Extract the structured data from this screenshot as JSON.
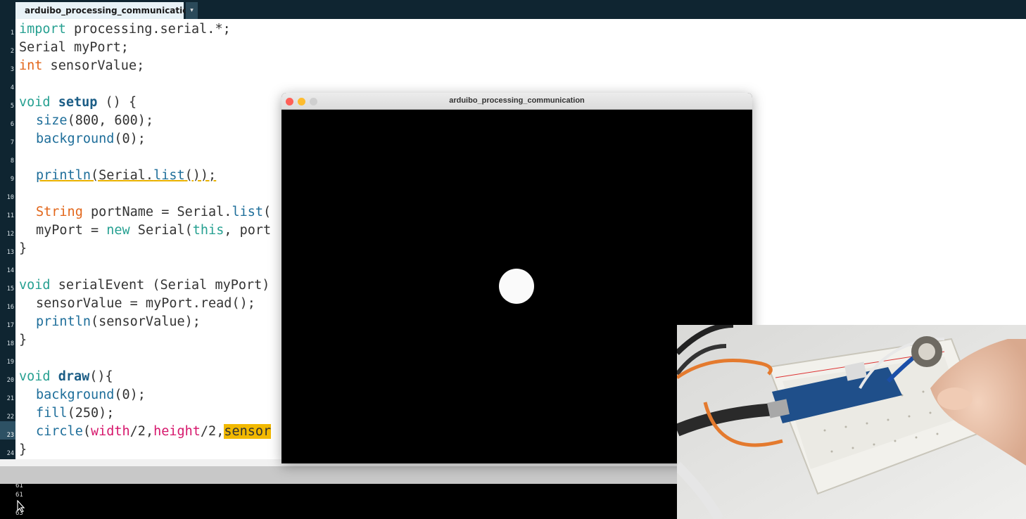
{
  "editor": {
    "tab_label": "arduibo_processing_communication",
    "tab_menu_icon": "▾",
    "current_line": 23,
    "lines": [
      {
        "n": "1"
      },
      {
        "n": "2"
      },
      {
        "n": "3"
      },
      {
        "n": "4"
      },
      {
        "n": "5"
      },
      {
        "n": "6"
      },
      {
        "n": "7"
      },
      {
        "n": "8"
      },
      {
        "n": "9"
      },
      {
        "n": "10"
      },
      {
        "n": "11"
      },
      {
        "n": "12"
      },
      {
        "n": "13"
      },
      {
        "n": "14"
      },
      {
        "n": "15"
      },
      {
        "n": "16"
      },
      {
        "n": "17"
      },
      {
        "n": "18"
      },
      {
        "n": "19"
      },
      {
        "n": "20"
      },
      {
        "n": "21"
      },
      {
        "n": "22"
      },
      {
        "n": "23"
      },
      {
        "n": "24"
      }
    ],
    "code": {
      "l1_kw": "import",
      "l1_rest": " processing.serial.*;",
      "l2": "Serial myPort;",
      "l3_kw": "int",
      "l3_rest": " sensorValue;",
      "l5_kw": "void",
      "l5_sp": " ",
      "l5_fn": "setup",
      "l5_rest": " () {",
      "l6_fn": "size",
      "l6_rest": "(800, 600);",
      "l7_fn": "background",
      "l7_rest": "(0);",
      "l9_fn": "println",
      "l9_a": "(Serial.",
      "l9_fn2": "list",
      "l9_b": "());",
      "l11_type": "String",
      "l11_a": " portName = Serial.",
      "l11_fn": "list",
      "l11_b": "(",
      "l12_a": "myPort = ",
      "l12_kw": "new",
      "l12_b": " Serial(",
      "l12_kw2": "this",
      "l12_c": ", port",
      "l13": "}",
      "l15_kw": "void",
      "l15_rest": " serialEvent (Serial myPort)",
      "l16": "sensorValue = myPort.read();",
      "l17_fn": "println",
      "l17_rest": "(sensorValue);",
      "l18": "}",
      "l20_kw": "void",
      "l20_sp": " ",
      "l20_fn": "draw",
      "l20_rest": "(){",
      "l21_fn": "background",
      "l21_rest": "(0);",
      "l22_fn": "fill",
      "l22_rest": "(250);",
      "l23_fn": "circle",
      "l23_a": "(",
      "l23_p1": "width",
      "l23_b": "/2,",
      "l23_p2": "height",
      "l23_c": "/2,",
      "l23_hl": "sensor",
      "l24": "}"
    }
  },
  "console": {
    "lines": [
      "61",
      "61",
      "63"
    ]
  },
  "sketch_window": {
    "title": "arduibo_processing_communication",
    "traffic_lights": {
      "close": "#fe5f57",
      "minimize": "#febc2e",
      "zoom": "#cfcfcf"
    },
    "circle_color": "#fafafa",
    "background_color": "#000000"
  },
  "colors": {
    "tab_bar": "#0f2531",
    "keyword": "#26a091",
    "function": "#1e6e9a",
    "type": "#e2661a",
    "highlight": "#f2b900"
  }
}
